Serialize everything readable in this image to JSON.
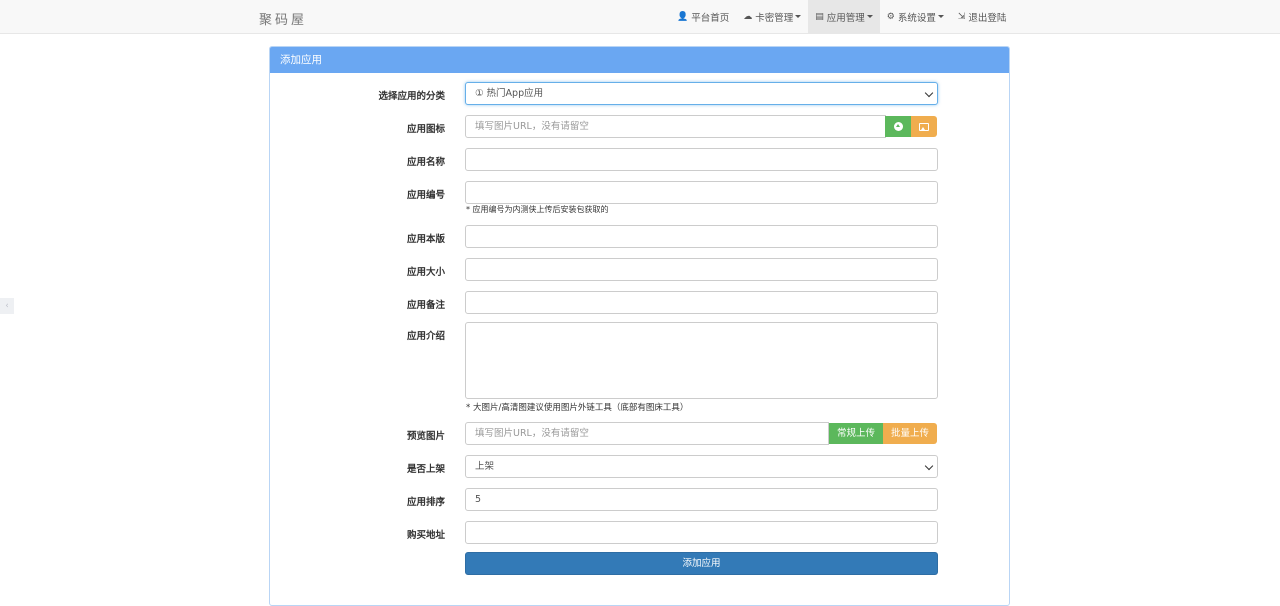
{
  "nav": {
    "brand": "聚码屋",
    "items": [
      {
        "label": "平台首页",
        "icon": "user-icon",
        "glyph": "👤",
        "caret": false,
        "active": false
      },
      {
        "label": "卡密管理",
        "icon": "cloud-icon",
        "glyph": "☁",
        "caret": true,
        "active": false
      },
      {
        "label": "应用管理",
        "icon": "list-icon",
        "glyph": "▤",
        "caret": true,
        "active": true
      },
      {
        "label": "系统设置",
        "icon": "gear-icon",
        "glyph": "⚙",
        "caret": true,
        "active": false
      },
      {
        "label": "退出登陆",
        "icon": "logout-icon",
        "glyph": "⇲",
        "caret": false,
        "active": false
      }
    ]
  },
  "side_tab": "‹",
  "panel": {
    "title": "添加应用",
    "category": {
      "label": "选择应用的分类",
      "value": "① 热门App应用"
    },
    "icon_field": {
      "label": "应用图标",
      "placeholder": "填写图片URL，没有请留空"
    },
    "name": {
      "label": "应用名称",
      "value": ""
    },
    "code": {
      "label": "应用编号",
      "value": "",
      "help": "* 应用编号为内测侠上传后安装包获取的"
    },
    "version": {
      "label": "应用本版",
      "value": ""
    },
    "size": {
      "label": "应用大小",
      "value": ""
    },
    "remark": {
      "label": "应用备注",
      "value": ""
    },
    "intro": {
      "label": "应用介绍",
      "value": "",
      "help": "* 大图片/高清图建议使用图片外链工具（底部有图床工具）"
    },
    "preview": {
      "label": "预览图片",
      "placeholder": "填写图片URL，没有请留空",
      "upload_label": "常规上传",
      "batch_label": "批量上传"
    },
    "listed": {
      "label": "是否上架",
      "value": "上架"
    },
    "sort": {
      "label": "应用排序",
      "value": "5"
    },
    "buy_url": {
      "label": "购买地址",
      "value": ""
    },
    "submit_label": "添加应用"
  },
  "colors": {
    "panel_heading": "#6aa7f2",
    "submit": "#337ab7",
    "green": "#5cb85c",
    "orange": "#f0ad4e"
  }
}
